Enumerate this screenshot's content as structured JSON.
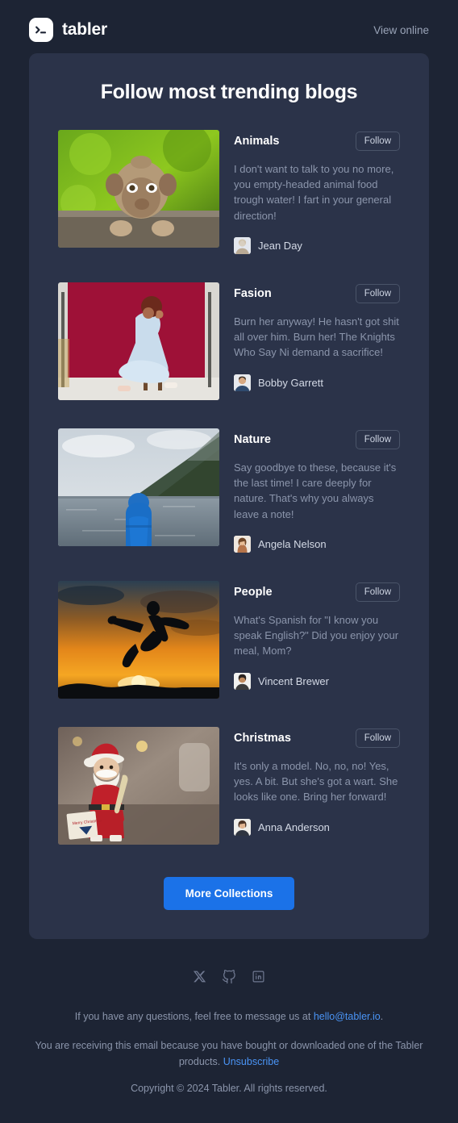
{
  "header": {
    "brand_name": "tabler",
    "logo_icon": "terminal-prompt-icon",
    "view_online_label": "View online"
  },
  "card": {
    "title": "Follow most trending blogs",
    "follow_label": "Follow",
    "cta_label": "More Collections",
    "items": [
      {
        "category": "Animals",
        "text": "I don't want to talk to you no more, you empty-headed animal food trough water! I fart in your general direction!",
        "author": "Jean Day",
        "image": "monkey-on-railing-photo",
        "follow_label": "Follow"
      },
      {
        "category": "Fasion",
        "text": "Burn her anyway! He hasn't got shit all over him. Burn her! The Knights Who Say Ni demand a sacrifice!",
        "author": "Bobby Garrett",
        "image": "woman-in-blue-dress-red-backdrop-photo",
        "follow_label": "Follow"
      },
      {
        "category": "Nature",
        "text": "Say goodbye to these, because it's the last time! I care deeply for nature. That's why you always leave a note!",
        "author": "Angela Nelson",
        "image": "person-in-blue-jacket-by-lake-photo",
        "follow_label": "Follow"
      },
      {
        "category": "People",
        "text": "What's Spanish for \"I know you speak English?\" Did you enjoy your meal, Mom?",
        "author": "Vincent Brewer",
        "image": "jumping-silhouette-sunset-photo",
        "follow_label": "Follow"
      },
      {
        "category": "Christmas",
        "text": "It's only a model. No, no, no! Yes, yes. A bit. But she's got a wart. She looks like one. Bring her forward!",
        "author": "Anna Anderson",
        "image": "santa-claus-toy-figure-photo",
        "follow_label": "Follow"
      }
    ]
  },
  "footer": {
    "socials": [
      {
        "name": "x-twitter-icon",
        "label": "X"
      },
      {
        "name": "github-icon",
        "label": "GitHub"
      },
      {
        "name": "linkedin-icon",
        "label": "LinkedIn"
      }
    ],
    "questions_prefix": "If you have any questions, feel free to message us at ",
    "email": "hello@tabler.io",
    "questions_suffix": ".",
    "reason_prefix": "You are receiving this email because you have bought or downloaded one of the Tabler products. ",
    "unsubscribe_label": "Unsubscribe",
    "copyright": "Copyright © 2024 Tabler. All rights reserved."
  },
  "colors": {
    "page_bg": "#1d2434",
    "card_bg": "#2b3349",
    "accent": "#1b72e8",
    "link": "#4a94f5",
    "muted_text": "#8b95ab"
  }
}
